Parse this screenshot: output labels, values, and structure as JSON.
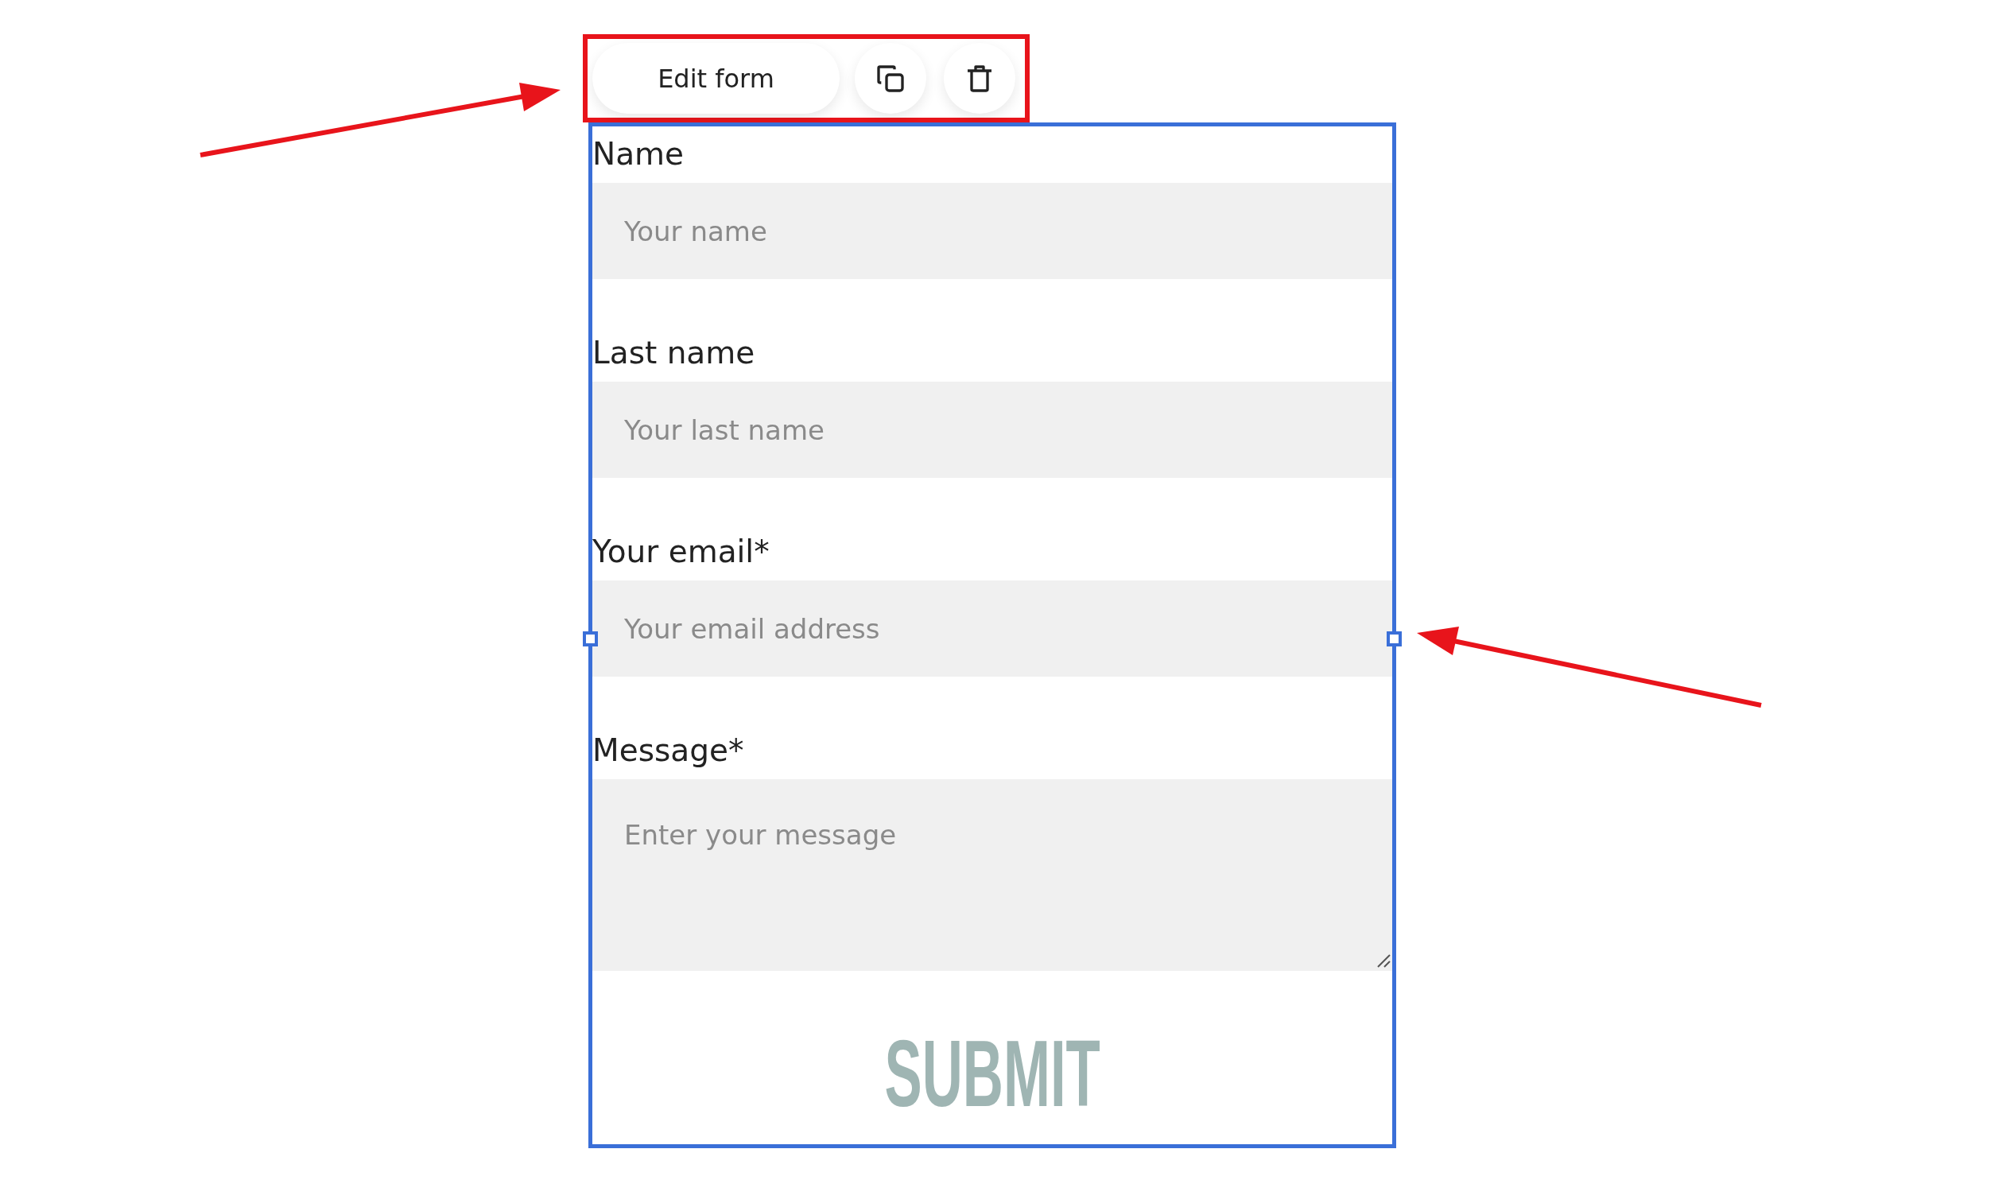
{
  "toolbar": {
    "edit_button": "Edit form"
  },
  "form": {
    "fields": [
      {
        "label": "Name",
        "placeholder": "Your name",
        "kind": "input"
      },
      {
        "label": "Last name",
        "placeholder": "Your last name",
        "kind": "input"
      },
      {
        "label": "Your email*",
        "placeholder": "Your email address",
        "kind": "input"
      },
      {
        "label": "Message*",
        "placeholder": "Enter your message",
        "kind": "textarea"
      }
    ],
    "submit": "SUBMIT"
  }
}
